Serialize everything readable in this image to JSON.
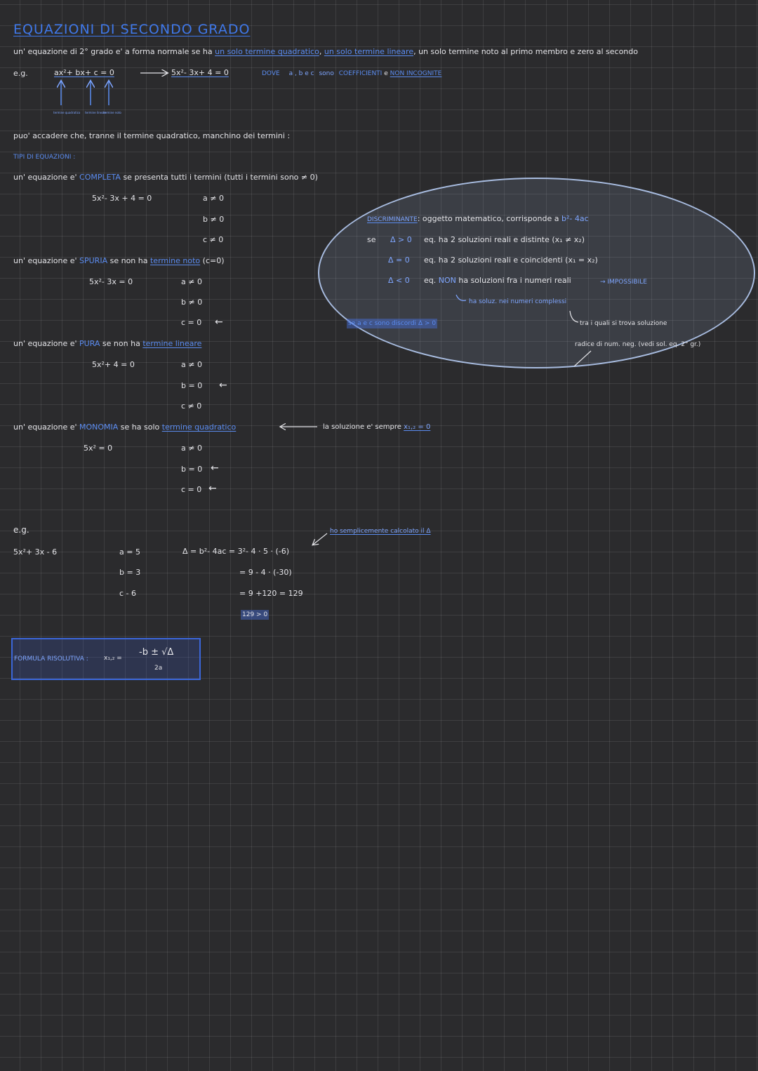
{
  "title": "EQUAZIONI DI SECONDO GRADO",
  "intro": {
    "a": "un' equazione di 2° grado e' a forma normale se ha ",
    "b": "un solo termine quadratico",
    "c": ", ",
    "d": "un solo termine lineare",
    "e": ", un solo termine noto al primo membro e zero al secondo"
  },
  "example1": {
    "label": "e.g.",
    "general": "ax²+ bx+ c = 0",
    "specific": "5x²- 3x+ 4 = 0",
    "dove": "DOVE",
    "abc": "a , b e c",
    "sono": "sono",
    "coeff": "COEFFICIENTI",
    "e": "e",
    "nonincognite": "NON INCOGNITE"
  },
  "arrow_labels": [
    "termine quadratico",
    "termine lineare",
    "termine noto"
  ],
  "note1": "puo' accadere che, tranne il termine quadratico, manchino dei termini :",
  "tipi": "TIPI DI EQUAZIONI :",
  "completa": {
    "desc_a": "un' equazione e' ",
    "type": "COMPLETA",
    "desc_b": " se presenta tutti i termini (tutti i termini sono ≠ 0)",
    "example": "5x²- 3x + 4 = 0",
    "conds": [
      "a ≠ 0",
      "b ≠ 0",
      "c ≠ 0"
    ]
  },
  "spuria": {
    "desc_a": "un' equazione e' ",
    "type": "SPURIA",
    "desc_b": " se non ha ",
    "desc_c": "termine noto",
    "desc_d": " (c=0)",
    "example": "5x²- 3x = 0",
    "conds": [
      "a ≠ 0",
      "b ≠ 0",
      "c = 0"
    ],
    "marker": "←"
  },
  "pura": {
    "desc_a": "un' equazione e' ",
    "type": "PURA",
    "desc_b": " se non ha ",
    "desc_c": "termine lineare",
    "example": "5x²+ 4 = 0",
    "conds": [
      "a ≠ 0",
      "b = 0",
      "c ≠ 0"
    ],
    "marker": "←"
  },
  "monomia": {
    "desc_a": "un' equazione e' ",
    "type": "MONOMIA",
    "desc_b": " se ha solo ",
    "desc_c": "termine quadratico",
    "example": "5x² = 0",
    "conds": [
      "a ≠ 0",
      "b = 0",
      "c = 0"
    ],
    "marker": "←",
    "solution_a": "la soluzione e' sempre",
    "solution_b": "x₁,₂ = 0"
  },
  "discriminante": {
    "label": "DISCRIMINANTE",
    "def": ": oggetto matematico, corrisponde a ",
    "formula": "b²- 4ac",
    "se": "se",
    "case1_cond": "Δ > 0",
    "case1_text": "eq. ha 2 soluzioni reali e distinte (x₁ ≠ x₂)",
    "case2_cond": "Δ = 0",
    "case2_text": "eq. ha 2 soluzioni reali e coincidenti (x₁ = x₂)",
    "case3_cond": "Δ < 0",
    "case3_text_a": "eq. ",
    "case3_non": "NON",
    "case3_text_b": " ha soluzioni fra i numeri reali",
    "impossibile": "→ IMPOSSIBILE",
    "complessi": "ha soluz. nei numeri complessi",
    "tra": "tra i quali si trova soluzione",
    "radice": "radice di num. neg. (vedi sol. eq. 2° gr.)",
    "discordi": "se a e c sono discordi Δ > 0"
  },
  "example2": {
    "label": "e.g.",
    "equation": "5x²+ 3x - 6",
    "a": "a = 5",
    "b": "b = 3",
    "c": "c - 6",
    "delta1": "Δ = b²- 4ac = 3²- 4 · 5 · (-6)",
    "delta2": "= 9 - 4 · (-30)",
    "delta3": "= 9 +120 = 129",
    "delta4": "129 > 0",
    "note": "ho semplicemente calcolato il Δ"
  },
  "formula": {
    "label": "FORMULA RISOLUTIVA :",
    "lhs": "x₁,₂ =",
    "numerator": "-b ± √Δ",
    "denominator": "2a"
  }
}
